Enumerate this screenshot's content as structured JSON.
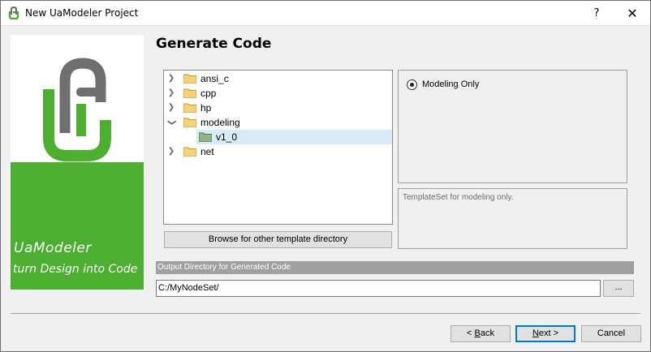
{
  "window": {
    "title": "New UaModeler Project",
    "help": "?",
    "close": "✕"
  },
  "banner": {
    "name": "UaModeler",
    "tagline": "turn Design into Code",
    "colors": {
      "green": "#4caf31",
      "logo_gray": "#6f6f6f"
    }
  },
  "page": {
    "title": "Generate Code"
  },
  "tree": {
    "items": [
      {
        "label": "ansi_c",
        "expanded": false
      },
      {
        "label": "cpp",
        "expanded": false
      },
      {
        "label": "hp",
        "expanded": false
      },
      {
        "label": "modeling",
        "expanded": true
      },
      {
        "label": "v1_0",
        "selected": true
      },
      {
        "label": "net",
        "expanded": false
      }
    ]
  },
  "options": {
    "radio_label": "Modeling Only",
    "description": "TemplateSet for modeling only."
  },
  "browse_label": "Browse for other template directory",
  "output": {
    "header": "Output Directory for Generated Code",
    "value": "C:/MyNodeSet/",
    "browse": "..."
  },
  "footer": {
    "back_u": "B",
    "back_rest": "ack",
    "back_prefix": "< ",
    "next_u": "N",
    "next_rest": "ext >",
    "cancel": "Cancel"
  }
}
